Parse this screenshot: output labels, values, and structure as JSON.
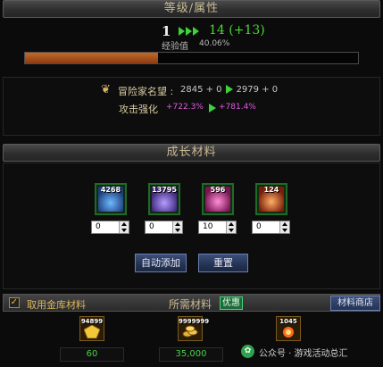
{
  "level_section": {
    "title": "等级/属性",
    "current_level": "1",
    "next_level": "14 (+13)",
    "exp_label": "经验值",
    "exp_percent_text": "40.06%",
    "exp_progress": 0.4006
  },
  "stats": {
    "fame_label": "冒险家名望 :",
    "fame_current": "2845 + 0",
    "fame_next": "2979 + 0",
    "attack_label": "攻击强化",
    "attack_current": "+722.3%",
    "attack_next": "+781.4%"
  },
  "materials_section": {
    "title": "成长材料",
    "items": [
      {
        "icon": "blue-material-icon",
        "count": "4268",
        "input_value": "0",
        "color": "#3c8ad8"
      },
      {
        "icon": "purple-material-icon",
        "count": "13795",
        "input_value": "0",
        "color": "#7b55d8"
      },
      {
        "icon": "pink-material-icon",
        "count": "596",
        "input_value": "10",
        "color": "#d63f9a"
      },
      {
        "icon": "red-material-icon",
        "count": "124",
        "input_value": "0",
        "color": "#d84a2a"
      }
    ],
    "auto_add_label": "自动添加",
    "reset_label": "重置"
  },
  "required_section": {
    "use_storage_label": "取用金库材料",
    "use_storage_checked": true,
    "title": "所需材料",
    "discount_label": "优惠",
    "shop_label": "材料商店",
    "items": [
      {
        "icon": "gold-gem-icon",
        "count": "94899",
        "required": "60"
      },
      {
        "icon": "gold-coins-icon",
        "count": "9999999",
        "required": "35,000"
      },
      {
        "icon": "fire-burst-icon",
        "count": "1045",
        "required": ""
      }
    ]
  },
  "watermark": {
    "text": "公众号 · 游戏活动总汇"
  },
  "colors": {
    "accent_green": "#4fd43a",
    "magenta": "#e05ae0",
    "header_text": "#c9b994"
  }
}
